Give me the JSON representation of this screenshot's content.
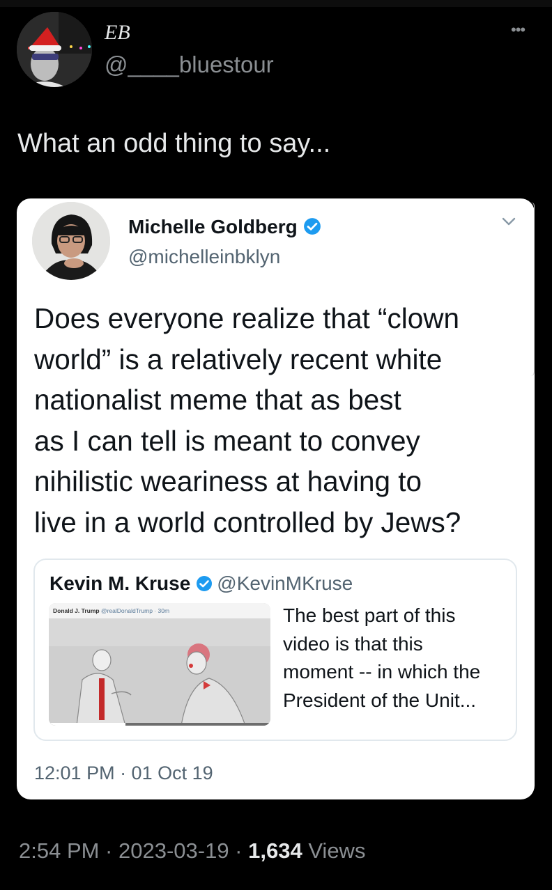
{
  "author": {
    "name": "EB",
    "handle": "@____bluestour"
  },
  "tweet": {
    "text": "What an odd thing to say...",
    "date_time": "2:54 PM · 2023-03-19 · ",
    "views_count": "1,634",
    "views_label": " Views"
  },
  "embedded": {
    "name": "Michelle Goldberg",
    "handle": "@michelleinbklyn",
    "text_lines": [
      "Does everyone realize that “clown",
      "world” is a relatively recent white",
      "nationalist meme that as best",
      "as I can tell is meant to convey",
      "nihilistic weariness at having to",
      "live in a world controlled by Jews?"
    ],
    "timestamp": "12:01 PM · 01 Oct 19",
    "quoted": {
      "name": "Kevin M. Kruse",
      "handle": "@KevinMKruse",
      "thumb_name": "Donald J. Trump",
      "thumb_handle": "@realDonaldTrump · 30m",
      "text_lines": [
        "The best part of this",
        "video is that this",
        "moment -- in which the",
        "President of the Unit..."
      ]
    }
  },
  "colors": {
    "background": "#000000",
    "card": "#ffffff",
    "verified": "#1d9bf0",
    "secondary_text": "#8b8f93"
  },
  "icons": [
    "more-icon",
    "verified-icon",
    "chevron-down-icon"
  ]
}
